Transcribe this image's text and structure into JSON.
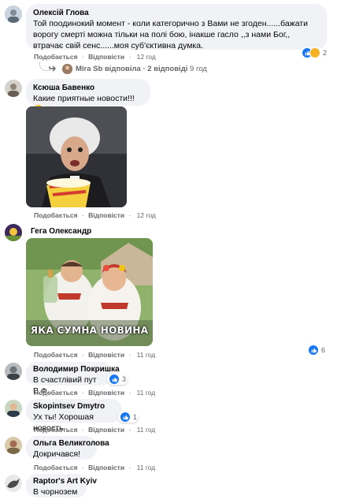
{
  "comments": [
    {
      "author": "Олексій Глова",
      "text": "Той поодинокий момент - коли категорично з Вами не згоден......бажати ворогу смерті можна тільки на полі бою, інакше гасло ,,з нами Бог,, втрачає свій сенс......моя суб'єктивна думка.",
      "like": "Подобається",
      "reply": "Відповісти",
      "time": "12 год",
      "reaction_count": "2"
    },
    {
      "author": "Ксюша Бавенко",
      "text": "Какие приятные новости!!!😊🙌",
      "like": "Подобається",
      "reply": "Відповісти",
      "time": "12 год"
    },
    {
      "author": "Гега Олександр",
      "meme_caption": "ЯКА СУМНА НОВИНА",
      "like": "Подобається",
      "reply": "Відповісти",
      "time": "11 год",
      "reaction_count": "6"
    },
    {
      "author": "Володимир Покришка",
      "text": "В счастлівий пут В.Ф.",
      "like": "Подобається",
      "reply": "Відповісти",
      "time": "11 год",
      "reaction_count": "3"
    },
    {
      "author": "Skopintsev Dmytro",
      "text": "Ух ты! Хорошая новость",
      "like": "Подобається",
      "reply": "Відповісти",
      "time": "11 год",
      "reaction_count": "1"
    },
    {
      "author": "Ольга Великголова",
      "text": "Докричався!",
      "like": "Подобається",
      "reply": "Відповісти",
      "time": "11 год"
    },
    {
      "author": "Raptor's Art Kyiv",
      "text": "В чорнозем"
    }
  ],
  "replies_summary": {
    "name": "Mira Sb",
    "text": "відповіла · 2 відповіді",
    "time": "9 год"
  },
  "colors": {
    "bubble": "#f0f2f5",
    "like_blue": "#1877f2",
    "muted": "#65676b"
  }
}
